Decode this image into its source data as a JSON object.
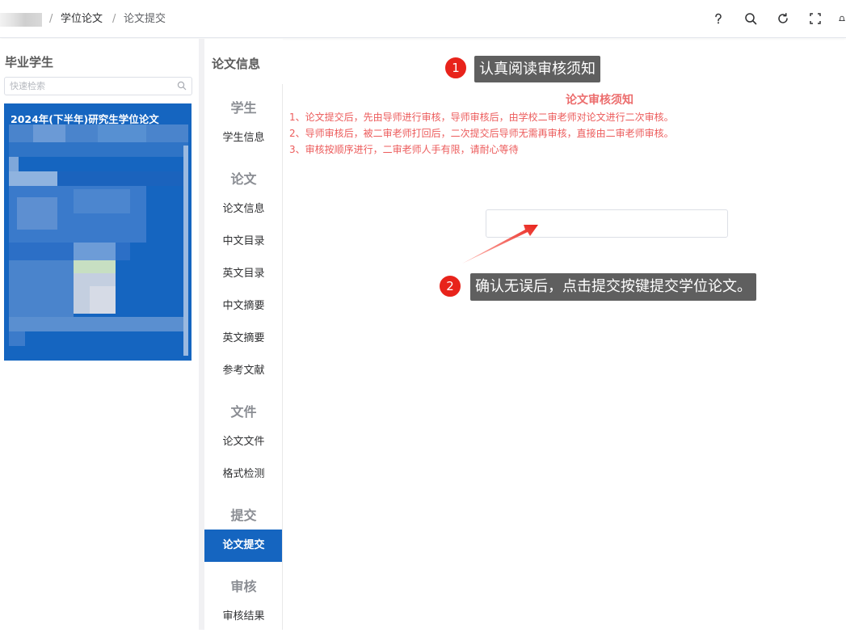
{
  "breadcrumb": {
    "sep1": "/",
    "item1": "学位论文",
    "sep2": "/",
    "item2": "论文提交"
  },
  "toolbar": {
    "help_icon": "help-icon",
    "search_icon": "search-icon",
    "refresh_icon": "refresh-icon",
    "fullscreen_icon": "fullscreen-icon",
    "bell_icon": "bell-icon"
  },
  "left_panel": {
    "title": "毕业学生",
    "search_placeholder": "快速检索",
    "card_title": "2024年(下半年)研究生学位论文"
  },
  "mid_nav": {
    "header": "论文信息",
    "groups": [
      {
        "label": "学生",
        "items": [
          "学生信息"
        ]
      },
      {
        "label": "论文",
        "items": [
          "论文信息",
          "中文目录",
          "英文目录",
          "中文摘要",
          "英文摘要",
          "参考文献"
        ]
      },
      {
        "label": "文件",
        "items": [
          "论文文件",
          "格式检测"
        ]
      },
      {
        "label": "提交",
        "items": [
          "论文提交"
        ]
      },
      {
        "label": "审核",
        "items": [
          "审核结果"
        ]
      }
    ],
    "active_item": "论文提交"
  },
  "notice": {
    "title": "论文审核须知",
    "lines": [
      "1、论文提交后，先由导师进行审核，导师审核后，由学校二审老师对论文进行二次审核。",
      "2、导师审核后，被二审老师打回后，二次提交后导师无需再审核，直接由二审老师审核。",
      "3、审核按顺序进行，二审老师人手有限，请耐心等待"
    ]
  },
  "submit_button": {
    "label": ""
  },
  "annotations": [
    {
      "number": "1",
      "text": "认真阅读审核须知"
    },
    {
      "number": "2",
      "text": "确认无误后，点击提交按键提交学位论文。"
    }
  ],
  "colors": {
    "primary": "#1565c0",
    "notice_red": "#ec5b5b",
    "badge_red": "#e8231b",
    "tip_gray": "#5f5f5f"
  }
}
